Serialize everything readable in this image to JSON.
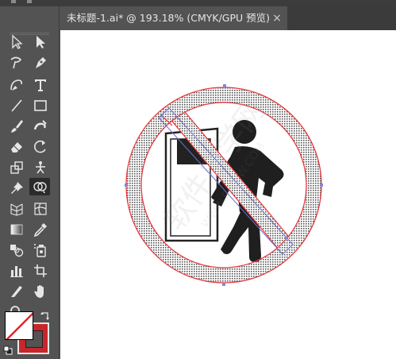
{
  "document": {
    "tab_title": "未标题-1.ai* @ 193.18% (CMYK/GPU 预览)",
    "close_glyph": "×"
  },
  "tools": [
    "selection-tool",
    "direct-selection-tool",
    "magic-wand-tool",
    "pen-tool",
    "curvature-tool",
    "type-tool",
    "line-segment-tool",
    "rectangle-tool",
    "paintbrush-tool",
    "blob-brush-tool",
    "eraser-tool",
    "rotate-tool",
    "scale-tool",
    "puppet-warp-tool",
    "pin-tool",
    "shape-builder-tool",
    "perspective-grid-tool",
    "mesh-tool",
    "gradient-tool",
    "eyedropper-tool",
    "blend-tool",
    "symbol-sprayer-tool",
    "column-graph-tool",
    "artboard-tool",
    "slice-tool",
    "hand-tool",
    "zoom-tool"
  ],
  "active_tool": "shape-builder-tool",
  "colors": {
    "stroke_red": "#e8383d",
    "fill_white": "#ffffff",
    "stroke_swatch": "#c7272b",
    "selection_blue": "#6e6ecf",
    "ui_dark": "#535353"
  }
}
